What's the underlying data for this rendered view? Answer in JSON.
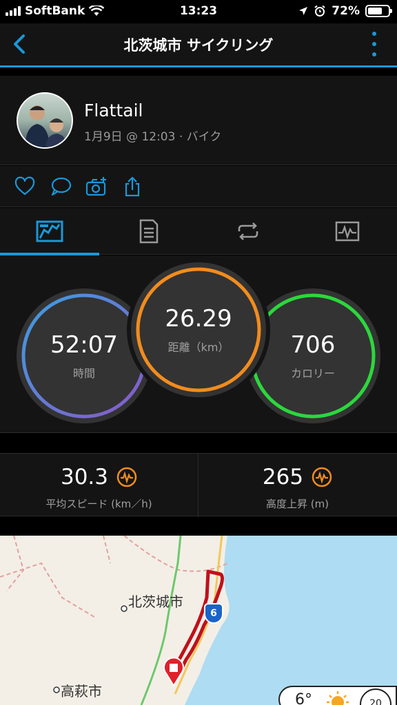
{
  "status_bar": {
    "carrier": "SoftBank",
    "time": "13:23",
    "battery": "72%"
  },
  "nav": {
    "title": "北茨城市 サイクリング"
  },
  "profile": {
    "name": "Flattail",
    "meta": "1月9日 @ 12:03 · バイク"
  },
  "rings": {
    "time": {
      "value": "52:07",
      "label": "時間",
      "color": "#4a7fd8"
    },
    "distance": {
      "value": "26.29",
      "label": "距離（km）",
      "color": "#f28c1e"
    },
    "calories": {
      "value": "706",
      "label": "カロリー",
      "color": "#2bd83c"
    }
  },
  "stats": {
    "speed": {
      "value": "30.3",
      "label": "平均スピード (km／h)"
    },
    "elevation": {
      "value": "265",
      "label": "高度上昇 (m)"
    }
  },
  "map": {
    "city1": "北茨城市",
    "city2": "高萩市",
    "route_shield": "6",
    "weather_temp": "6°",
    "wind": "20"
  },
  "colors": {
    "accent": "#1a98d8",
    "badge": "#f28c1e",
    "route": "#c0101c"
  }
}
